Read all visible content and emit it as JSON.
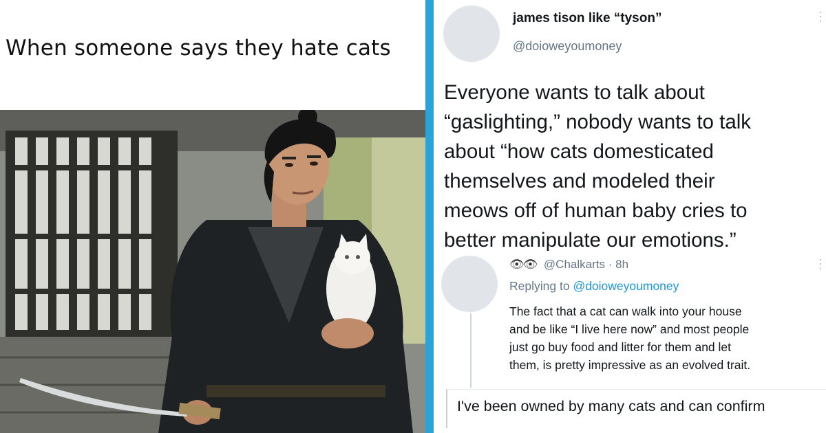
{
  "meme": {
    "caption": "When someone says they hate cats",
    "photo_description_icon": "samurai-with-cat-photo"
  },
  "tweet": {
    "display_name": "james tison like “tyson”",
    "handle": "@doioweyoumoney",
    "text_lines": [
      "Everyone wants to talk about",
      "“gaslighting,” nobody wants to talk",
      "about “how cats domesticated",
      "themselves and modeled their",
      "meows off of human baby cries to",
      "better manipulate our emotions.”"
    ]
  },
  "reply": {
    "eyes": "👁👁",
    "handle": "@Chalkarts",
    "separator": "·",
    "time": "8h",
    "replying_prefix": "Replying to",
    "replying_to": "@doioweyoumoney",
    "text_lines": [
      "The fact that a cat can walk into your house",
      "and be like “I live here now” and most people",
      "just go buy food and litter for them and let",
      "them, is pretty impressive as an evolved trait."
    ]
  },
  "bottom_reply": {
    "text": "I've been owned by many cats and can confirm"
  },
  "colors": {
    "divider": "#2aa3d9",
    "mention": "#1b95e0",
    "secondary_text": "#657786"
  }
}
